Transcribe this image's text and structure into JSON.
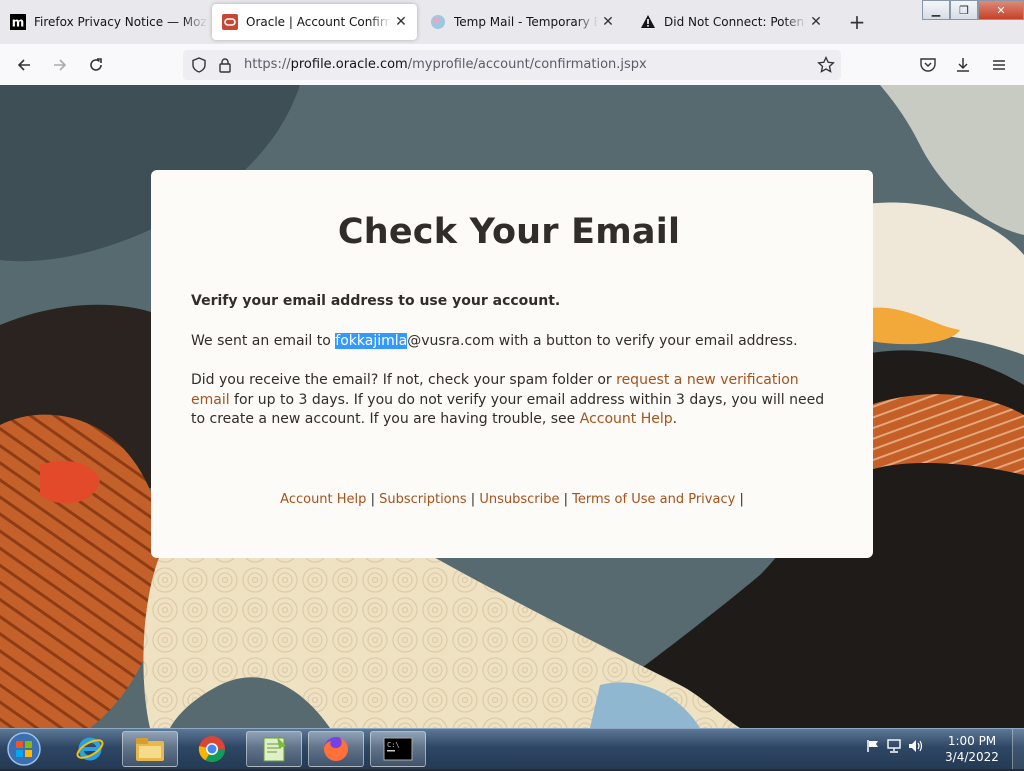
{
  "browser": {
    "tabs": [
      {
        "title": "Firefox Privacy Notice — Mozilla",
        "icon": "mozilla-m-icon",
        "active": false
      },
      {
        "title": "Oracle | Account Confirmation",
        "icon": "oracle-icon",
        "active": true
      },
      {
        "title": "Temp Mail - Temporary Email",
        "icon": "tempmail-icon",
        "active": false
      },
      {
        "title": "Did Not Connect: Potential Security Issue",
        "icon": "warning-icon",
        "active": false
      }
    ],
    "url": {
      "scheme": "https://",
      "host": "profile.oracle.com",
      "path": "/myprofile/account/confirmation.jspx"
    }
  },
  "page": {
    "heading": "Check Your Email",
    "lead": "Verify your email address to use your account.",
    "sent": {
      "before": "We sent an email to ",
      "selected": "fokkajimla",
      "after": "@vusra.com with a button to verify your email address."
    },
    "help": {
      "part1": "Did you receive the email? If not, check your spam folder or ",
      "link1": "request a new verification email",
      "part2": " for up to 3 days. If you do not verify your email address within 3 days, you will need to create a new account. If you are having trouble, see ",
      "link2": "Account Help",
      "part3": "."
    },
    "footer_links": [
      "Account Help",
      "Subscriptions",
      "Unsubscribe",
      "Terms of Use and Privacy"
    ],
    "footer_sep": "|",
    "colors": {
      "link": "#a6521b",
      "text": "#312d2a",
      "selection": "#3399ff"
    }
  },
  "taskbar": {
    "apps": [
      "start-button",
      "internet-explorer-icon",
      "file-explorer-icon",
      "chrome-icon",
      "notepadpp-icon",
      "firefox-icon",
      "cmd-icon"
    ],
    "tray_icons": [
      "flag-icon",
      "network-icon",
      "volume-icon"
    ],
    "time": "1:00 PM",
    "date": "3/4/2022"
  }
}
